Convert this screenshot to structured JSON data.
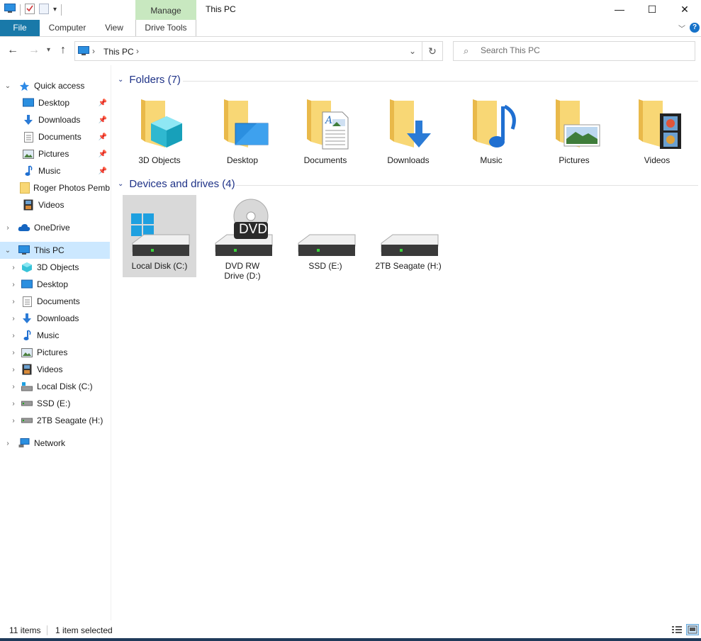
{
  "title_bar": {
    "title": "This PC",
    "manage_label": "Manage",
    "controls": {
      "minimize": "—",
      "maximize": "☐",
      "close": "✕"
    }
  },
  "ribbon": {
    "tabs": [
      {
        "label": "File"
      },
      {
        "label": "Computer"
      },
      {
        "label": "View"
      },
      {
        "label": "Drive Tools"
      }
    ],
    "help": "?"
  },
  "address": {
    "crumb": "This PC",
    "search_placeholder": "Search This PC"
  },
  "nav": {
    "quick_access": "Quick access",
    "quick_items": [
      {
        "label": "Desktop",
        "icon": "desktop-icon",
        "pinned": true
      },
      {
        "label": "Downloads",
        "icon": "downloads-icon",
        "pinned": true
      },
      {
        "label": "Documents",
        "icon": "documents-icon",
        "pinned": true
      },
      {
        "label": "Pictures",
        "icon": "pictures-icon",
        "pinned": true
      },
      {
        "label": "Music",
        "icon": "music-icon",
        "pinned": true
      },
      {
        "label": "Roger Photos Pemb",
        "icon": "folder-icon",
        "pinned": false
      },
      {
        "label": "Videos",
        "icon": "videos-icon",
        "pinned": false
      }
    ],
    "onedrive": "OneDrive",
    "this_pc": "This PC",
    "pc_items": [
      {
        "label": "3D Objects",
        "icon": "3d-objects-icon"
      },
      {
        "label": "Desktop",
        "icon": "desktop-icon"
      },
      {
        "label": "Documents",
        "icon": "documents-icon"
      },
      {
        "label": "Downloads",
        "icon": "downloads-icon"
      },
      {
        "label": "Music",
        "icon": "music-icon"
      },
      {
        "label": "Pictures",
        "icon": "pictures-icon"
      },
      {
        "label": "Videos",
        "icon": "videos-icon"
      },
      {
        "label": "Local Disk (C:)",
        "icon": "local-disk-icon"
      },
      {
        "label": "SSD (E:)",
        "icon": "drive-icon"
      },
      {
        "label": "2TB Seagate (H:)",
        "icon": "drive-icon"
      }
    ],
    "network": "Network"
  },
  "content": {
    "folders_header": "Folders (7)",
    "folders": [
      {
        "label": "3D Objects",
        "icon": "3d-objects-folder-icon"
      },
      {
        "label": "Desktop",
        "icon": "desktop-folder-icon"
      },
      {
        "label": "Documents",
        "icon": "documents-folder-icon"
      },
      {
        "label": "Downloads",
        "icon": "downloads-folder-icon"
      },
      {
        "label": "Music",
        "icon": "music-folder-icon"
      },
      {
        "label": "Pictures",
        "icon": "pictures-folder-icon"
      },
      {
        "label": "Videos",
        "icon": "videos-folder-icon"
      }
    ],
    "drives_header": "Devices and drives (4)",
    "drives": [
      {
        "label": "Local Disk (C:)",
        "icon": "windows-drive-icon",
        "selected": true
      },
      {
        "label": "DVD RW Drive (D:)",
        "icon": "dvd-drive-icon",
        "selected": false,
        "badge": "DVD"
      },
      {
        "label": "SSD (E:)",
        "icon": "drive-icon",
        "selected": false
      },
      {
        "label": "2TB Seagate (H:)",
        "icon": "drive-icon",
        "selected": false
      }
    ]
  },
  "status": {
    "items": "11 items",
    "selected": "1 item selected"
  },
  "colors": {
    "file_tab": "#1979a9",
    "manage_tab": "#c8e8c0",
    "selection": "#cce8ff",
    "group_header": "#1e3287",
    "folder_yellow": "#f8d775"
  }
}
